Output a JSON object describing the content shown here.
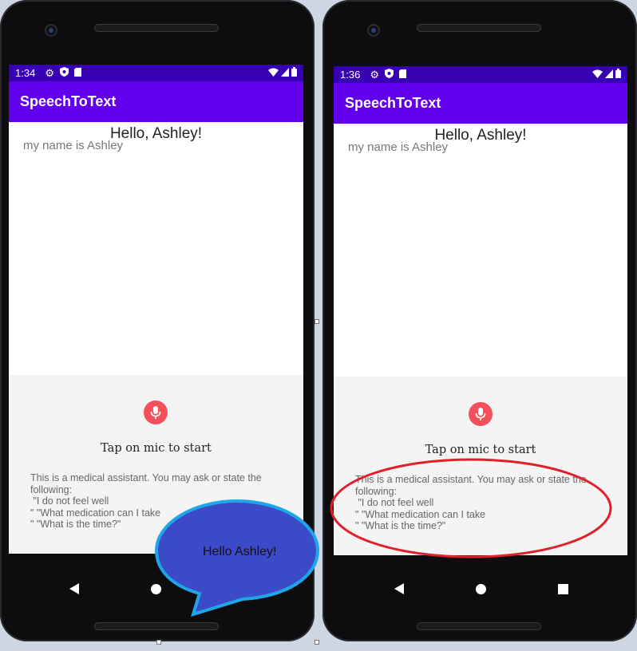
{
  "devices": [
    {
      "status_time": "1:34",
      "app_title": "SpeechToText",
      "greeting": "Hello, Ashley!",
      "transcript": "my name is Ashley",
      "tap_label": "Tap on mic to start",
      "instructions": [
        "This is a medical assistant. You may ask or state the",
        "following:",
        " \"I do not feel well",
        "\" \"What medication can I take",
        "\" \"What is the time?\""
      ]
    },
    {
      "status_time": "1:36",
      "app_title": "SpeechToText",
      "greeting": "Hello, Ashley!",
      "transcript": "my name is Ashley",
      "tap_label": "Tap on mic to start",
      "instructions": [
        "This is a medical assistant. You may ask or state the",
        "following:",
        " \"I do not feel well",
        "\" \"What medication can I take",
        "\" \"What is the time?\""
      ]
    }
  ],
  "annotations": {
    "speech_bubble_text": "Hello Ashley!"
  },
  "colors": {
    "status_bar": "#3700b3",
    "app_bar": "#6200ee",
    "mic": "#f4505a",
    "bubble_fill": "#3b4bc8",
    "bubble_stroke": "#1ea7e8",
    "highlight_ring": "#e0202a"
  }
}
